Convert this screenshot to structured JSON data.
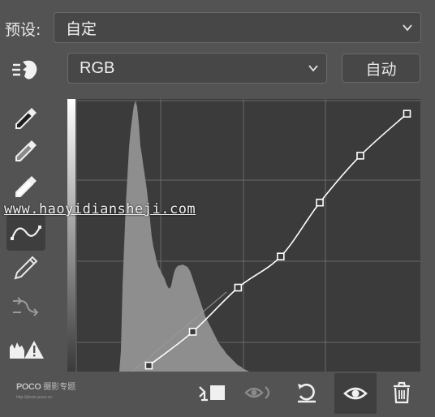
{
  "header": {
    "preset_label": "预设:",
    "preset_value": "自定",
    "channel_value": "RGB",
    "auto_label": "自动"
  },
  "tools": [
    {
      "name": "on-image-adjust-icon"
    },
    {
      "name": "black-point-eyedropper-icon"
    },
    {
      "name": "gray-point-eyedropper-icon"
    },
    {
      "name": "white-point-eyedropper-icon"
    },
    {
      "name": "curve-edit-points-icon",
      "selected": true
    },
    {
      "name": "pencil-draw-icon"
    },
    {
      "name": "smooth-curve-icon"
    },
    {
      "name": "clipping-warning-icon"
    }
  ],
  "watermark": "www.haoyidiansheji.com",
  "logo": {
    "main": "POCO",
    "sub": "摄影专题",
    "url": "http://photo.poco.cn"
  },
  "curve": {
    "points": [
      [
        0.209,
        0.022
      ],
      [
        0.337,
        0.146
      ],
      [
        0.469,
        0.308
      ],
      [
        0.593,
        0.422
      ],
      [
        0.707,
        0.62
      ],
      [
        0.825,
        0.792
      ],
      [
        0.961,
        0.946
      ]
    ]
  },
  "footer": [
    {
      "name": "clip-to-layer-icon"
    },
    {
      "name": "view-previous-state-icon"
    },
    {
      "name": "reset-icon"
    },
    {
      "name": "visibility-eye-icon",
      "selected": true
    },
    {
      "name": "trash-icon"
    }
  ],
  "colors": {
    "panel": "#535353",
    "graph_bg": "#3b3b3b",
    "histogram": "#8e8e8e",
    "curve": "#ffffff"
  }
}
